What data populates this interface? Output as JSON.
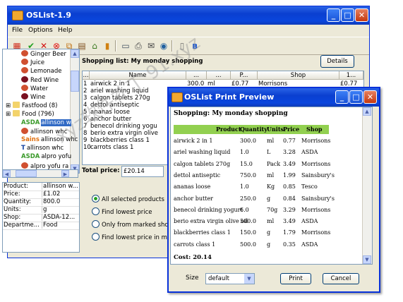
{
  "main_window": {
    "title": "OSList-1.9",
    "menu": [
      "File",
      "Options",
      "Help"
    ]
  },
  "tree": {
    "items": [
      {
        "label": "Ginger Beer",
        "indent": 2,
        "icon": "drink"
      },
      {
        "label": "Juice",
        "indent": 2,
        "icon": "drink"
      },
      {
        "label": "Lemonade",
        "indent": 2,
        "icon": "drink"
      },
      {
        "label": "Red Wine",
        "indent": 2,
        "icon": "wine"
      },
      {
        "label": "Water",
        "indent": 2,
        "icon": "drink"
      },
      {
        "label": "Wine",
        "indent": 2,
        "icon": "wine"
      },
      {
        "label": "Fastfood (8)",
        "indent": 0,
        "icon": "folder"
      },
      {
        "label": "Food (796)",
        "indent": 0,
        "icon": "folder"
      },
      {
        "label": "allinson w",
        "indent": 2,
        "brand": "ASDA",
        "selected": true
      },
      {
        "label": "allinson whc",
        "indent": 2,
        "brand": "",
        "icon": "bag"
      },
      {
        "label": "allinson whc",
        "indent": 2,
        "brand": "Sains"
      },
      {
        "label": "allinson whc",
        "indent": 2,
        "brand": "T"
      },
      {
        "label": "alpro yofu",
        "indent": 2,
        "brand": "ASDA"
      },
      {
        "label": "alpro yofu ra",
        "indent": 2,
        "icon": "bag"
      }
    ]
  },
  "details": [
    {
      "key": "Product:",
      "value": "allinson w..."
    },
    {
      "key": "Price:",
      "value": "£1.02"
    },
    {
      "key": "Quantity:",
      "value": "800.0"
    },
    {
      "key": "Units:",
      "value": "g"
    },
    {
      "key": "Shop:",
      "value": "ASDA-12..."
    },
    {
      "key": "Departme...",
      "value": "Food"
    }
  ],
  "shopping": {
    "label": "Shopping list: My monday shopping",
    "details_button": "Details",
    "columns": [
      "...",
      "Name",
      "...",
      "...",
      "P...",
      "Shop",
      "1..."
    ],
    "rows": [
      {
        "n": "1",
        "name": "airwick 2 in 1",
        "qty": "300.0",
        "unit": "ml",
        "price": "£0.77",
        "shop": "Morrisons",
        "last": "£0.77"
      },
      {
        "n": "2",
        "name": "ariel washing liquid"
      },
      {
        "n": "3",
        "name": "calgon tablets 270g"
      },
      {
        "n": "4",
        "name": "dettol antiseptic"
      },
      {
        "n": "5",
        "name": "ananas loose"
      },
      {
        "n": "6",
        "name": "anchor butter"
      },
      {
        "n": "7",
        "name": "benecol drinking yogu"
      },
      {
        "n": "8",
        "name": "berio extra virgin olive"
      },
      {
        "n": "9",
        "name": "blackberries class 1"
      },
      {
        "n": "10",
        "name": "carrots class 1"
      }
    ],
    "total_label": "Total price:",
    "total_value": "£20.14",
    "options": [
      "All selected products",
      "Find lowest price",
      "Only from marked shops",
      "Find lowest price in marked"
    ]
  },
  "preview": {
    "title": "OSList Print Preview",
    "heading": "Shopping: My monday shopping",
    "columns": [
      "Product",
      "Quantity",
      "Units",
      "Price",
      "Shop"
    ],
    "rows": [
      {
        "product": "airwick 2 in 1",
        "qty": "300.0",
        "unit": "ml",
        "price": "0.77",
        "shop": "Morrisons"
      },
      {
        "product": "ariel washing liquid",
        "qty": "1.0",
        "unit": "L",
        "price": "3.28",
        "shop": "ASDA"
      },
      {
        "product": "calgon tablets 270g",
        "qty": "15.0",
        "unit": "Pack",
        "price": "3.49",
        "shop": "Morrisons"
      },
      {
        "product": "dettol antiseptic",
        "qty": "750.0",
        "unit": "ml",
        "price": "1.99",
        "shop": "Sainsbury's"
      },
      {
        "product": "ananas loose",
        "qty": "1.0",
        "unit": "Kg",
        "price": "0.85",
        "shop": "Tesco"
      },
      {
        "product": "anchor butter",
        "qty": "250.0",
        "unit": "g",
        "price": "0.84",
        "shop": "Sainsbury's"
      },
      {
        "product": "benecol drinking yogurt",
        "qty": "6.0",
        "unit": "70g",
        "price": "3.29",
        "shop": "Morrisons"
      },
      {
        "product": "berio extra virgin olive oil",
        "qty": "500.0",
        "unit": "ml",
        "price": "3.49",
        "shop": "ASDA"
      },
      {
        "product": "blackberries class 1",
        "qty": "150.0",
        "unit": "g",
        "price": "1.79",
        "shop": "Morrisons"
      },
      {
        "product": "carrots class 1",
        "qty": "500.0",
        "unit": "g",
        "price": "0.35",
        "shop": "ASDA"
      }
    ],
    "cost": "Cost: 20.14",
    "size_label": "Size",
    "size_value": "default",
    "print_button": "Print",
    "cancel_button": "Cancel"
  },
  "watermark": "xyz软件补丁 91.xyz",
  "colors": {
    "titlebar": "#0a3fd0",
    "preview_header": "#92d050",
    "selection": "#316ac5"
  }
}
